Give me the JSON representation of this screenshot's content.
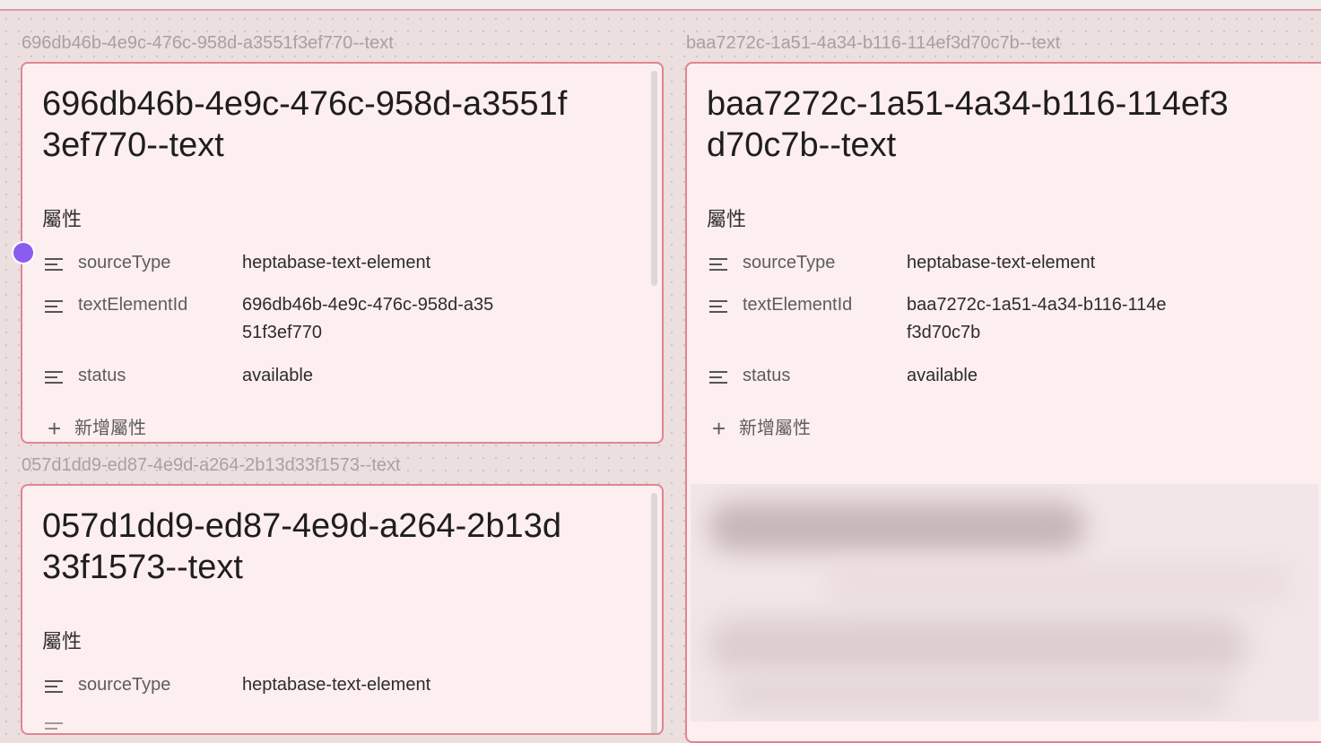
{
  "cards": [
    {
      "label": "696db46b-4e9c-476c-958d-a3551f3ef770--text",
      "title": "696db46b-4e9c-476c-958d-a3551f3ef770--text",
      "section_title": "屬性",
      "properties": [
        {
          "key": "sourceType",
          "value": "heptabase-text-element"
        },
        {
          "key": "textElementId",
          "value": "696db46b-4e9c-476c-958d-a3551f3ef770"
        },
        {
          "key": "status",
          "value": "available"
        }
      ],
      "add_property": "新增屬性"
    },
    {
      "label": "baa7272c-1a51-4a34-b116-114ef3d70c7b--text",
      "title": "baa7272c-1a51-4a34-b116-114ef3d70c7b--text",
      "section_title": "屬性",
      "properties": [
        {
          "key": "sourceType",
          "value": "heptabase-text-element"
        },
        {
          "key": "textElementId",
          "value": "baa7272c-1a51-4a34-b116-114ef3d70c7b"
        },
        {
          "key": "status",
          "value": "available"
        }
      ],
      "add_property": "新增屬性"
    },
    {
      "label": "057d1dd9-ed87-4e9d-a264-2b13d33f1573--text",
      "title": "057d1dd9-ed87-4e9d-a264-2b13d33f1573--text",
      "section_title": "屬性",
      "properties": [
        {
          "key": "sourceType",
          "value": "heptabase-text-element"
        }
      ]
    }
  ],
  "colors": {
    "canvas": "#ecdfe0",
    "card_background": "#fdeef0",
    "card_border": "#e0868f",
    "connector": "#8a5cf0"
  },
  "icons": {
    "property": "text-lines-icon",
    "add": "plus-icon",
    "connector": "connection-dot-icon"
  }
}
